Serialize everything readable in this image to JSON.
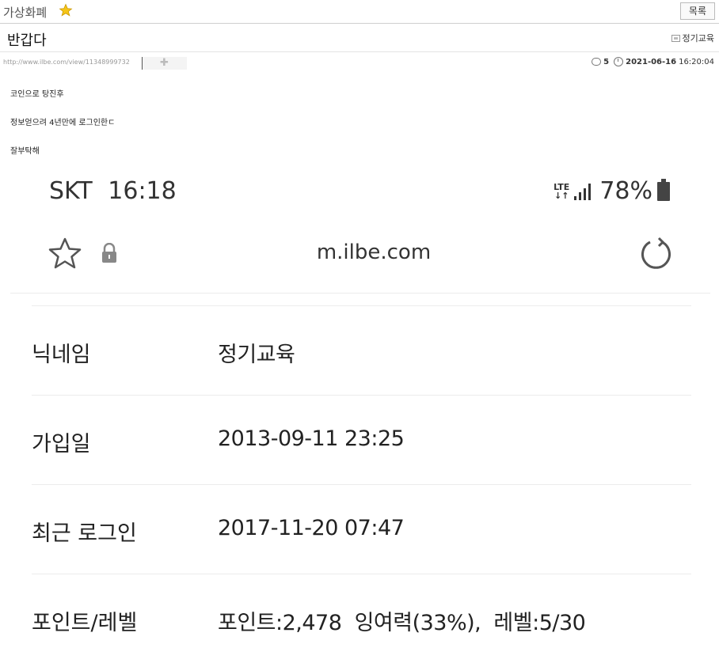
{
  "board": {
    "name": "가상화폐",
    "list_button": "목록"
  },
  "post": {
    "title": "반갑다",
    "author": "정기교육",
    "url": "http://www.ilbe.com/view/11348999732",
    "comments": "5",
    "date": "2021-06-16",
    "time": "16:20:04",
    "body": [
      "코인으로 탕진후",
      "정보얻으려 4년만에 로그인한ㄷ",
      "잘부탁해"
    ]
  },
  "screenshot": {
    "carrier": "SKT",
    "clock": "16:18",
    "network_top": "LTE",
    "network_bottom": "↓↑",
    "battery": "78%",
    "domain": "m.ilbe.com",
    "rows": [
      {
        "label": "닉네임",
        "value": "정기교육"
      },
      {
        "label": "가입일",
        "value": "2013-09-11 23:25"
      },
      {
        "label": "최근 로그인",
        "value": "2017-11-20 07:47"
      },
      {
        "label": "포인트/레벨",
        "value": "포인트:2,478  잉여력(33%),  레벨:5/30"
      }
    ]
  },
  "colors": {
    "star": "#f5c518",
    "divider": "#ececec"
  },
  "icons": [
    "star-icon",
    "author-icon",
    "puzzle-icon",
    "comment-icon",
    "clock-icon",
    "lte-icon",
    "signal-icon",
    "battery-icon",
    "lock-icon",
    "reload-icon"
  ]
}
